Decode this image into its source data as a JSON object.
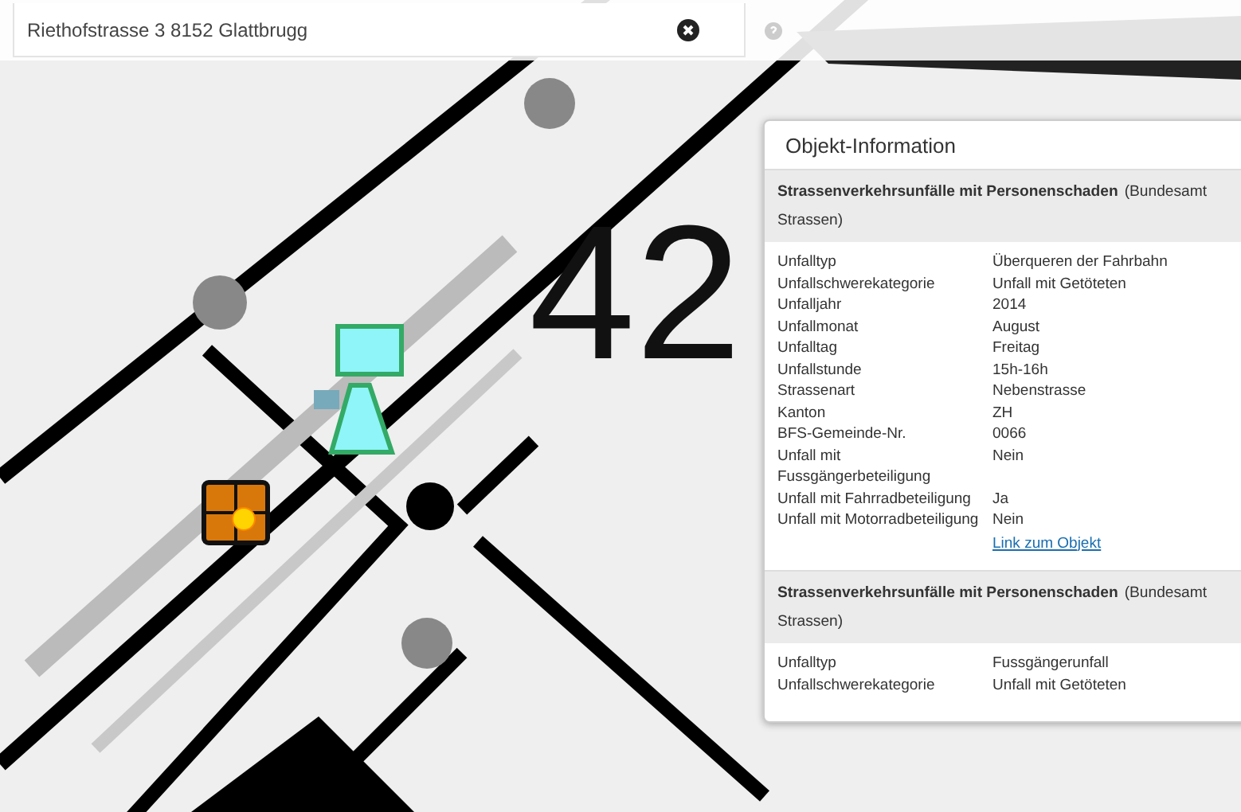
{
  "search": {
    "value": "Riethofstrasse 3 8152 Glattbrugg"
  },
  "map": {
    "label": "42"
  },
  "popup": {
    "title": "Objekt-Information",
    "sections": [
      {
        "title": "Strassenverkehrsunfälle mit Personenschaden",
        "source": "(Bundesamt",
        "source_cont": "Strassen)",
        "rows": [
          {
            "label": "Unfalltyp",
            "value": "Überqueren der Fahrbahn"
          },
          {
            "label": "Unfallschwerekategorie",
            "value": "Unfall mit Getöteten"
          },
          {
            "label": "Unfalljahr",
            "value": "2014"
          },
          {
            "label": "Unfallmonat",
            "value": "August"
          },
          {
            "label": "Unfalltag",
            "value": "Freitag"
          },
          {
            "label": "Unfallstunde",
            "value": "15h-16h"
          },
          {
            "label": "Strassenart",
            "value": "Nebenstrasse"
          },
          {
            "label": "Kanton",
            "value": "ZH"
          },
          {
            "label": "BFS-Gemeinde-Nr.",
            "value": "0066"
          },
          {
            "label": "Unfall mit Fussgängerbeteiligung",
            "value": "Nein"
          },
          {
            "label": "Unfall mit Fahrradbeteiligung",
            "value": "Ja"
          },
          {
            "label": "Unfall mit Motorradbeteiligung",
            "value": "Nein"
          }
        ],
        "link": "Link zum Objekt"
      },
      {
        "title": "Strassenverkehrsunfälle mit Personenschaden",
        "source": "(Bundesamt",
        "source_cont": "Strassen)",
        "rows": [
          {
            "label": "Unfalltyp",
            "value": "Fussgängerunfall"
          },
          {
            "label": "Unfallschwerekategorie",
            "value": "Unfall mit Getöteten"
          }
        ]
      }
    ]
  }
}
